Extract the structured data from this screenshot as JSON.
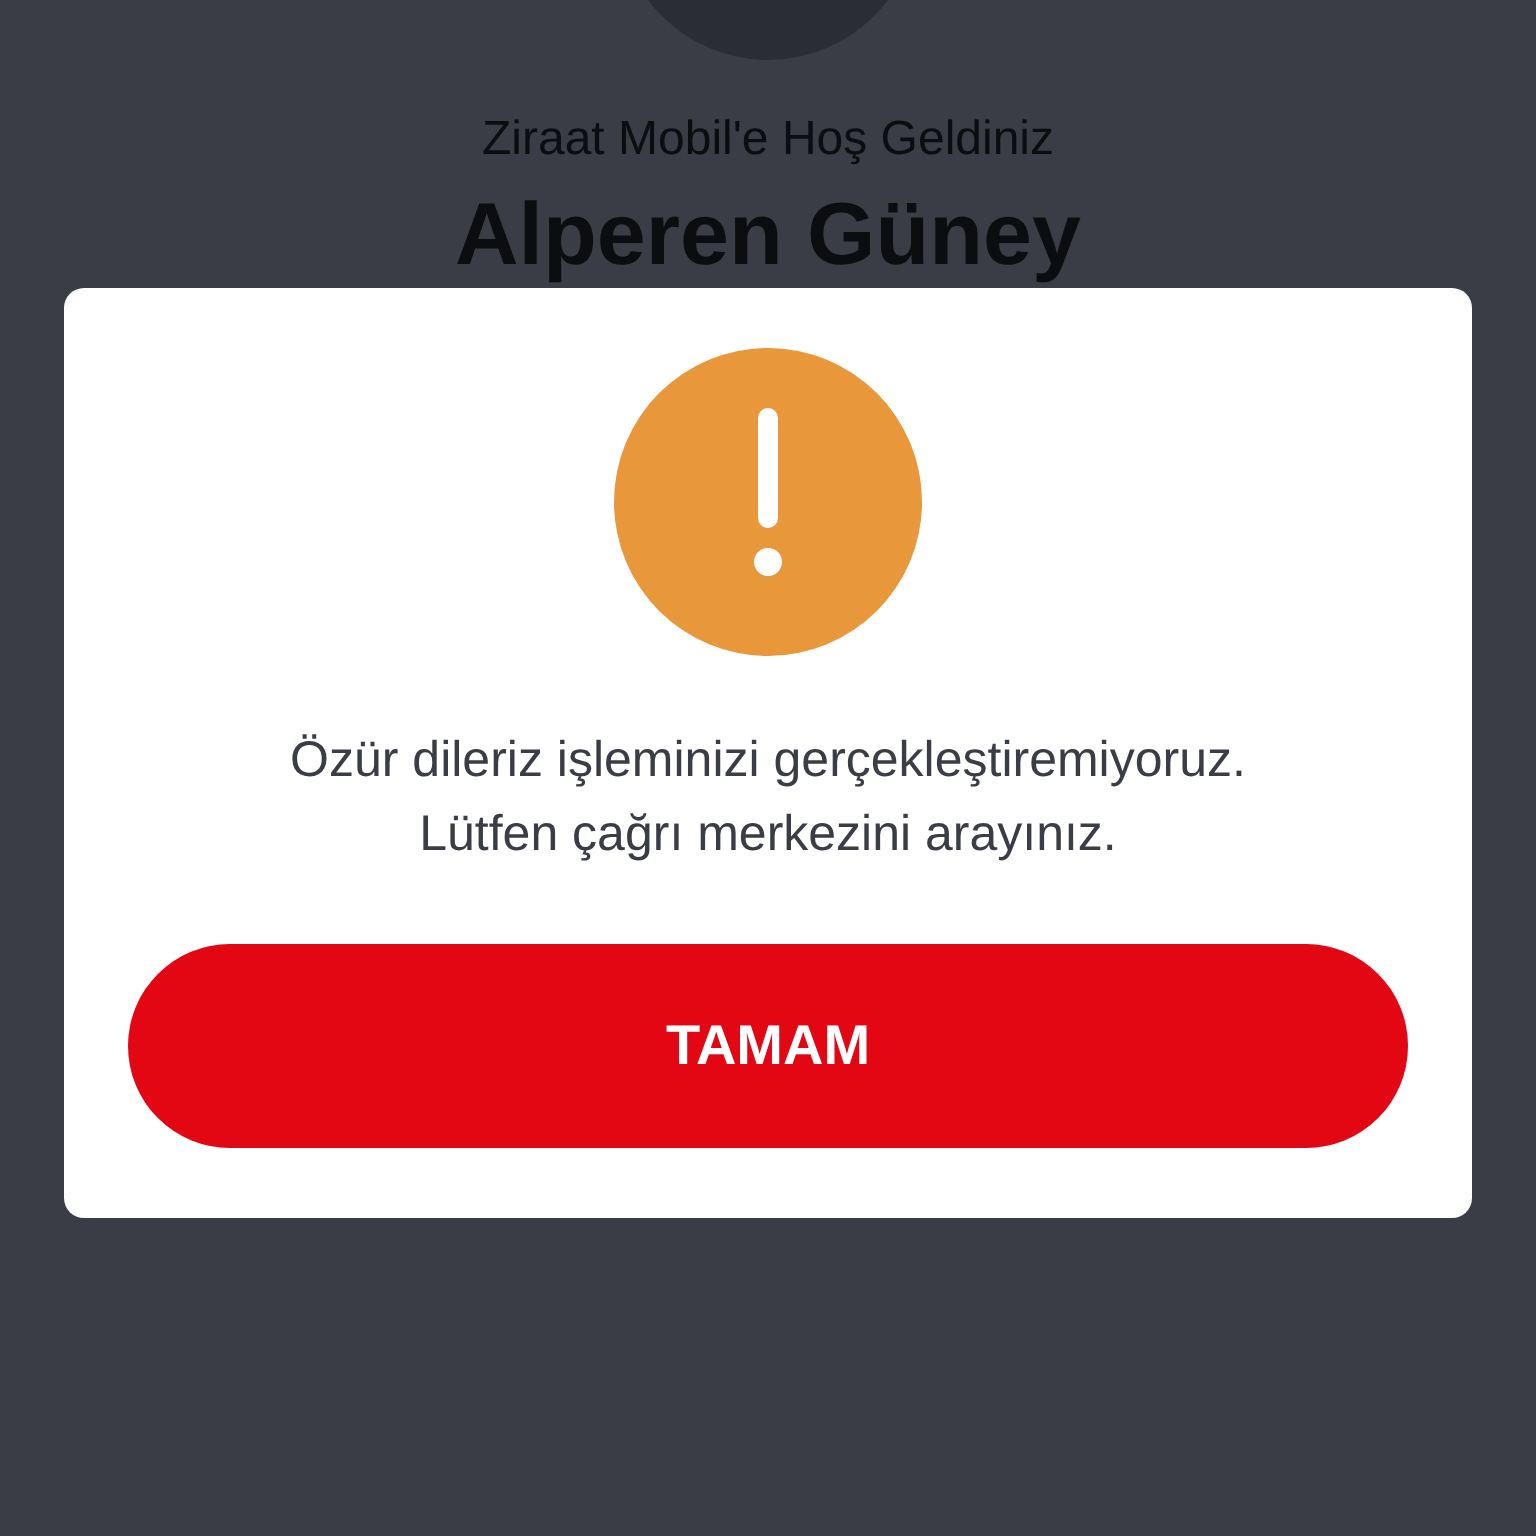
{
  "background": {
    "greeting": "Ziraat Mobil'e Hoş Geldiniz",
    "user_name": "Alperen Güney"
  },
  "dialog": {
    "kind": "warning",
    "message_lines": [
      "Özür dileriz işleminizi gerçekleştiremiyoruz.",
      "Lütfen çağrı merkezini arayınız."
    ],
    "button": "TAMAM"
  }
}
